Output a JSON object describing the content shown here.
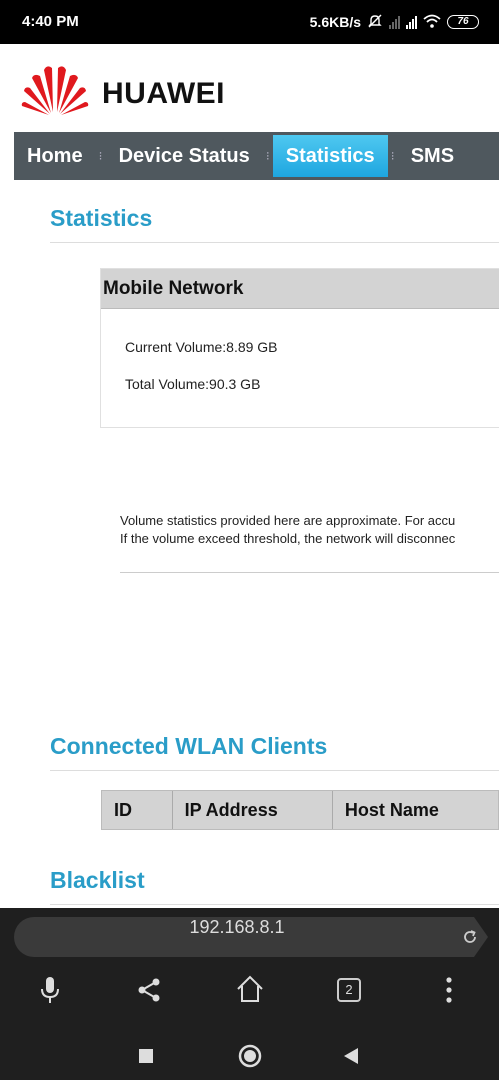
{
  "status_bar": {
    "time": "4:40 PM",
    "speed": "5.6KB/s",
    "battery": "76"
  },
  "header": {
    "brand": "HUAWEI"
  },
  "nav": {
    "items": [
      "Home",
      "Device Status",
      "Statistics",
      "SMS"
    ],
    "active": "Statistics"
  },
  "statistics": {
    "title": "Statistics",
    "mobile_network": {
      "header": "Mobile Network",
      "current_volume": "Current Volume:8.89 GB",
      "total_volume": "Total Volume:90.3 GB"
    },
    "note_line1": "Volume statistics provided here are approximate. For accu",
    "note_line2": "If the volume exceed threshold, the network will disconnec"
  },
  "wlan": {
    "title": "Connected WLAN Clients",
    "columns": [
      "ID",
      "IP Address",
      "Host Name"
    ]
  },
  "blacklist": {
    "title": "Blacklist"
  },
  "browser": {
    "url": "192.168.8.1",
    "tab_count": "2"
  },
  "colors": {
    "accent": "#2a9dc8",
    "nav_bg": "#4f585e",
    "nav_active": "#29b0e8",
    "logo_red": "#e0191e"
  }
}
